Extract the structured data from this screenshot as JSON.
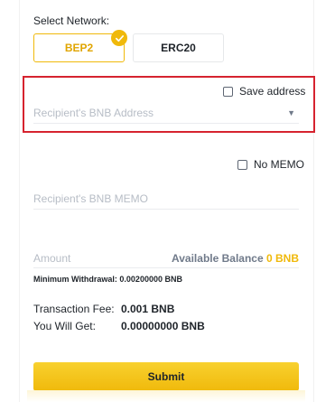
{
  "network": {
    "label": "Select Network:",
    "options": [
      {
        "label": "BEP2",
        "selected": true
      },
      {
        "label": "ERC20",
        "selected": false
      }
    ]
  },
  "address": {
    "save_label": "Save address",
    "save_checked": false,
    "placeholder": "Recipient's BNB Address"
  },
  "memo": {
    "no_memo_label": "No MEMO",
    "no_memo_checked": false,
    "placeholder": "Recipient's BNB MEMO"
  },
  "amount": {
    "placeholder": "Amount",
    "balance_label": "Available Balance",
    "balance_value": "0 BNB",
    "min_withdrawal": "Minimum Withdrawal: 0.00200000 BNB"
  },
  "summary": {
    "fee_label": "Transaction Fee:",
    "fee_value": "0.001 BNB",
    "get_label": "You Will Get:",
    "get_value": "0.00000000 BNB"
  },
  "submit_label": "Submit",
  "colors": {
    "accent": "#f0b90b",
    "highlight_border": "#d6232f"
  }
}
